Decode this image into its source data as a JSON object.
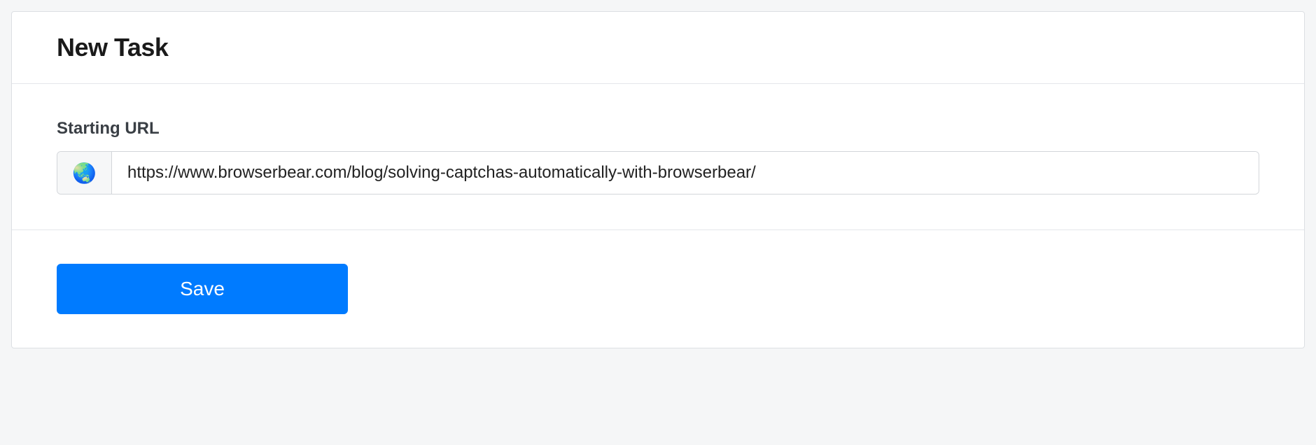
{
  "header": {
    "title": "New Task"
  },
  "form": {
    "url_label": "Starting URL",
    "url_value": "https://www.browserbear.com/blog/solving-captchas-automatically-with-browserbear/",
    "icon_glyph": "🌏"
  },
  "footer": {
    "save_label": "Save"
  }
}
